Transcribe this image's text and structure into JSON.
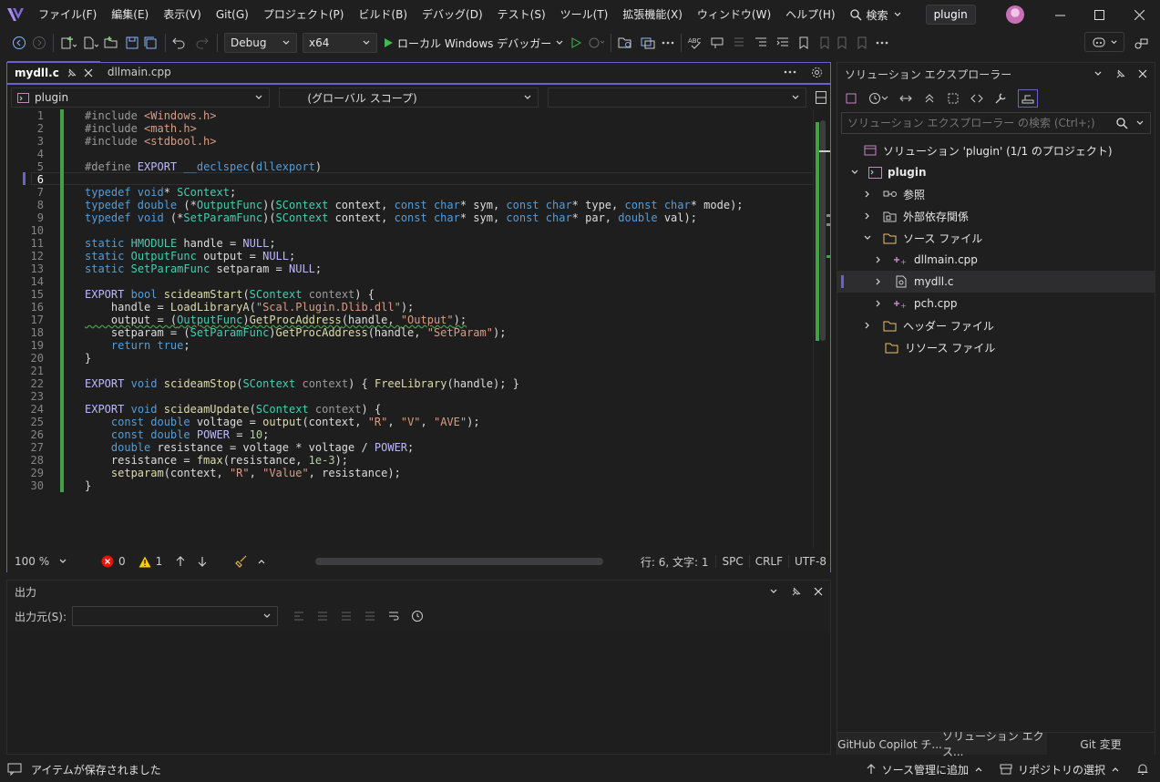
{
  "menu": [
    "ファイル(F)",
    "編集(E)",
    "表示(V)",
    "Git(G)",
    "プロジェクト(P)",
    "ビルド(B)",
    "デバッグ(D)",
    "テスト(S)",
    "ツール(T)",
    "拡張機能(X)",
    "ウィンドウ(W)",
    "ヘルプ(H)"
  ],
  "search_label": "検索",
  "solution_name": "plugin",
  "toolbar": {
    "config": "Debug",
    "platform": "x64",
    "run_label": "ローカル Windows デバッガー"
  },
  "tabs": [
    {
      "label": "mydll.c"
    },
    {
      "label": "dllmain.cpp"
    }
  ],
  "nav": {
    "project": "plugin",
    "scope": "(グローバル スコープ)",
    "member": ""
  },
  "code_lines": [
    "1",
    "2",
    "3",
    "4",
    "5",
    "6",
    "7",
    "8",
    "9",
    "10",
    "11",
    "12",
    "13",
    "14",
    "15",
    "16",
    "17",
    "18",
    "19",
    "20",
    "21",
    "22",
    "23",
    "24",
    "25",
    "26",
    "27",
    "28",
    "29",
    "30"
  ],
  "editor_status": {
    "zoom": "100 %",
    "errors": "0",
    "warnings": "1",
    "position": "行: 6, 文字: 1",
    "spc": "SPC",
    "eol": "CRLF",
    "encoding": "UTF-8"
  },
  "output": {
    "title": "出力",
    "source_label": "出力元(S):",
    "source_value": ""
  },
  "solution_explorer": {
    "title": "ソリューション エクスプローラー",
    "search_placeholder": "ソリューション エクスプローラー の検索 (Ctrl+;)",
    "items": [
      {
        "label": "ソリューション 'plugin' (1/1 のプロジェクト)"
      },
      {
        "label": "plugin"
      },
      {
        "label": "参照"
      },
      {
        "label": "外部依存関係"
      },
      {
        "label": "ソース ファイル"
      },
      {
        "label": "dllmain.cpp"
      },
      {
        "label": "mydll.c"
      },
      {
        "label": "pch.cpp"
      },
      {
        "label": "ヘッダー ファイル"
      },
      {
        "label": "リソース ファイル"
      }
    ],
    "bottom_tabs": [
      "GitHub Copilot チ...",
      "ソリューション エクス...",
      "Git 変更"
    ]
  },
  "status": {
    "message": "アイテムが保存されました",
    "source_control": "ソース管理に追加",
    "repository": "リポジトリの選択"
  },
  "colors": {
    "accent": "#6c5fcf",
    "modified_bar": "#43a047",
    "error": "#e51400",
    "warning": "#ffcc00"
  }
}
